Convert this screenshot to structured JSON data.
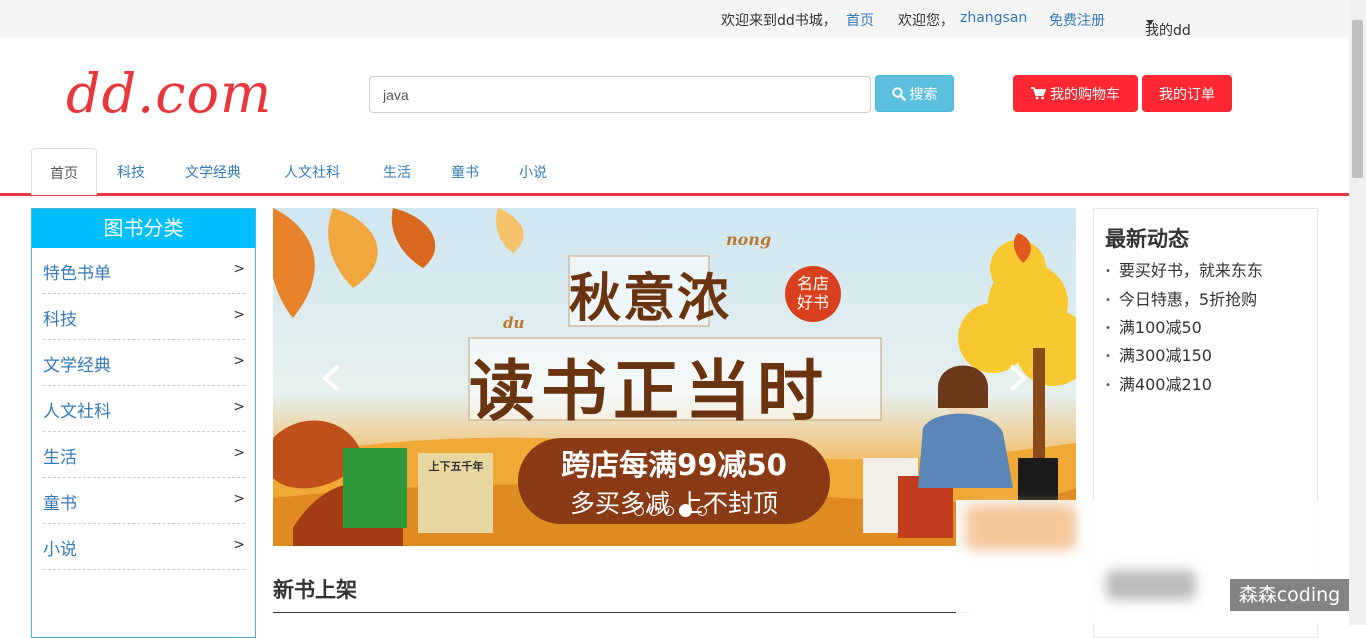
{
  "topbar": {
    "welcome": "欢迎来到dd书城，",
    "home": "首页",
    "hello": "欢迎您，",
    "username": "zhangsan",
    "register": "免费注册",
    "my_dd": "我的dd"
  },
  "header": {
    "logo": "dd.com",
    "search_value": "java",
    "search_button": "搜索",
    "cart_button": "我的购物车",
    "order_button": "我的订单"
  },
  "nav": {
    "tabs": [
      "首页",
      "科技",
      "文学经典",
      "人文社科",
      "生活",
      "童书",
      "小说"
    ]
  },
  "sidebar": {
    "title": "图书分类",
    "items": [
      "特色书单",
      "科技",
      "文学经典",
      "人文社科",
      "生活",
      "童书",
      "小说"
    ],
    "arrow": ">"
  },
  "banner": {
    "pinyin_top": "nong",
    "line1": "秋意浓",
    "badge": "名店好书",
    "pinyin_mid": "du",
    "line2": "读书正当时",
    "promo1": "跨店每满99减50",
    "promo2": "多买多减 上不封顶",
    "book1": "上下五千年",
    "active_slide": 4,
    "slide_count": 5
  },
  "news": {
    "title": "最新动态",
    "items": [
      "要买好书，就来东东",
      "今日特惠，5折抢购",
      "满100减50",
      "满300减150",
      "满400减210"
    ]
  },
  "main": {
    "section_title": "新书上架"
  },
  "watermark": "森森coding",
  "colors": {
    "brand_red": "#e8363d",
    "button_red": "#ff2832",
    "info_blue": "#5bc0de",
    "sidebar_head": "#00bfff",
    "link_blue": "#337ab7"
  }
}
